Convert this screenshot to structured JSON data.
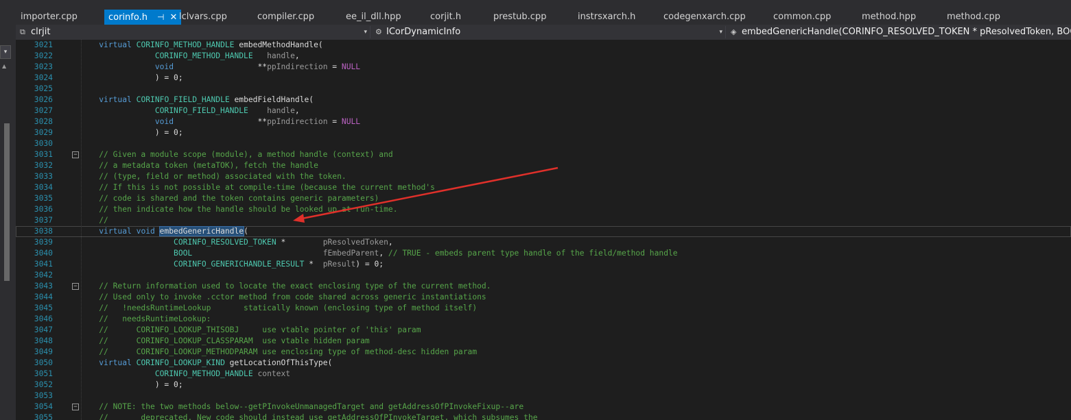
{
  "tabs": [
    {
      "label": "importer.cpp",
      "active": false
    },
    {
      "label": "corinfo.h",
      "active": true
    },
    {
      "label": "lclvars.cpp",
      "active": false
    },
    {
      "label": "compiler.cpp",
      "active": false
    },
    {
      "label": "ee_il_dll.hpp",
      "active": false
    },
    {
      "label": "corjit.h",
      "active": false
    },
    {
      "label": "prestub.cpp",
      "active": false
    },
    {
      "label": "instrsxarch.h",
      "active": false
    },
    {
      "label": "codegenxarch.cpp",
      "active": false
    },
    {
      "label": "common.cpp",
      "active": false
    },
    {
      "label": "method.hpp",
      "active": false
    },
    {
      "label": "method.cpp",
      "active": false
    }
  ],
  "tab_pin_glyph": "⊣",
  "tab_close_glyph": "✕",
  "left_close_glyph": "✕",
  "left_drop_glyph": "▾",
  "left_scroll_arrow_glyph": "▲",
  "navbar": {
    "project": "clrjit",
    "scope": "ICorDynamicInfo",
    "member": "embedGenericHandle(CORINFO_RESOLVED_TOKEN * pResolvedToken, BOOL fEm",
    "chevron_glyph": "▾"
  },
  "icons": {
    "project": "project-icon",
    "scope": "class-icon",
    "member": "method-icon"
  },
  "code_lines": [
    {
      "n": "3021",
      "fold": false,
      "tokens": [
        [
          "    ",
          ""
        ],
        [
          "virtual ",
          "kw"
        ],
        [
          "CORINFO_METHOD_HANDLE",
          "ty"
        ],
        [
          " embedMethodHandle(",
          ""
        ]
      ]
    },
    {
      "n": "3022",
      "fold": false,
      "tokens": [
        [
          "                ",
          ""
        ],
        [
          "CORINFO_METHOD_HANDLE",
          "ty"
        ],
        [
          "   ",
          ""
        ],
        [
          "handle",
          "pr"
        ],
        [
          ",",
          ""
        ]
      ]
    },
    {
      "n": "3023",
      "fold": false,
      "tokens": [
        [
          "                ",
          ""
        ],
        [
          "void",
          "kw"
        ],
        [
          "                  **",
          ""
        ],
        [
          "ppIndirection",
          "pr"
        ],
        [
          " = ",
          ""
        ],
        [
          "NULL",
          "mac"
        ]
      ]
    },
    {
      "n": "3024",
      "fold": false,
      "tokens": [
        [
          "                ) = 0;",
          ""
        ]
      ]
    },
    {
      "n": "3025",
      "fold": false,
      "tokens": []
    },
    {
      "n": "3026",
      "fold": false,
      "tokens": [
        [
          "    ",
          ""
        ],
        [
          "virtual ",
          "kw"
        ],
        [
          "CORINFO_FIELD_HANDLE",
          "ty"
        ],
        [
          " embedFieldHandle(",
          ""
        ]
      ]
    },
    {
      "n": "3027",
      "fold": false,
      "tokens": [
        [
          "                ",
          ""
        ],
        [
          "CORINFO_FIELD_HANDLE",
          "ty"
        ],
        [
          "    ",
          ""
        ],
        [
          "handle",
          "pr"
        ],
        [
          ",",
          ""
        ]
      ]
    },
    {
      "n": "3028",
      "fold": false,
      "tokens": [
        [
          "                ",
          ""
        ],
        [
          "void",
          "kw"
        ],
        [
          "                  **",
          ""
        ],
        [
          "ppIndirection",
          "pr"
        ],
        [
          " = ",
          ""
        ],
        [
          "NULL",
          "mac"
        ]
      ]
    },
    {
      "n": "3029",
      "fold": false,
      "tokens": [
        [
          "                ) = 0;",
          ""
        ]
      ]
    },
    {
      "n": "3030",
      "fold": false,
      "tokens": []
    },
    {
      "n": "3031",
      "fold": true,
      "tokens": [
        [
          "    ",
          ""
        ],
        [
          "// Given a module scope (module), a method handle (context) and",
          "cm"
        ]
      ]
    },
    {
      "n": "3032",
      "fold": false,
      "tokens": [
        [
          "    ",
          ""
        ],
        [
          "// a metadata token (metaTOK), fetch the handle",
          "cm"
        ]
      ]
    },
    {
      "n": "3033",
      "fold": false,
      "tokens": [
        [
          "    ",
          ""
        ],
        [
          "// (type, field or method) associated with the token.",
          "cm"
        ]
      ]
    },
    {
      "n": "3034",
      "fold": false,
      "tokens": [
        [
          "    ",
          ""
        ],
        [
          "// If this is not possible at compile-time (because the current method's",
          "cm"
        ]
      ]
    },
    {
      "n": "3035",
      "fold": false,
      "tokens": [
        [
          "    ",
          ""
        ],
        [
          "// code is shared and the token contains generic parameters)",
          "cm"
        ]
      ]
    },
    {
      "n": "3036",
      "fold": false,
      "tokens": [
        [
          "    ",
          ""
        ],
        [
          "// then indicate how the handle should be looked up at run-time.",
          "cm"
        ]
      ]
    },
    {
      "n": "3037",
      "fold": false,
      "tokens": [
        [
          "    ",
          ""
        ],
        [
          "//",
          "cm"
        ]
      ]
    },
    {
      "n": "3038",
      "fold": false,
      "current": true,
      "tokens": [
        [
          "    ",
          ""
        ],
        [
          "virtual ",
          "kw"
        ],
        [
          "void ",
          "kw"
        ],
        [
          "embedGenericHandle",
          "hl"
        ],
        [
          "(",
          ""
        ]
      ]
    },
    {
      "n": "3039",
      "fold": false,
      "tokens": [
        [
          "                    ",
          ""
        ],
        [
          "CORINFO_RESOLVED_TOKEN",
          "ty"
        ],
        [
          " *        ",
          ""
        ],
        [
          "pResolvedToken",
          "pr"
        ],
        [
          ",",
          ""
        ]
      ]
    },
    {
      "n": "3040",
      "fold": false,
      "tokens": [
        [
          "                    ",
          ""
        ],
        [
          "BOOL",
          "ty"
        ],
        [
          "                            ",
          ""
        ],
        [
          "fEmbedParent",
          "pr"
        ],
        [
          ", ",
          ""
        ],
        [
          "// TRUE - embeds parent type handle of the field/method handle",
          "cm"
        ]
      ]
    },
    {
      "n": "3041",
      "fold": false,
      "tokens": [
        [
          "                    ",
          ""
        ],
        [
          "CORINFO_GENERICHANDLE_RESULT",
          "ty"
        ],
        [
          " *  ",
          ""
        ],
        [
          "pResult",
          "pr"
        ],
        [
          ") = 0;",
          ""
        ]
      ]
    },
    {
      "n": "3042",
      "fold": false,
      "tokens": []
    },
    {
      "n": "3043",
      "fold": true,
      "tokens": [
        [
          "    ",
          ""
        ],
        [
          "// Return information used to locate the exact enclosing type of the current method.",
          "cm"
        ]
      ]
    },
    {
      "n": "3044",
      "fold": false,
      "tokens": [
        [
          "    ",
          ""
        ],
        [
          "// Used only to invoke .cctor method from code shared across generic instantiations",
          "cm"
        ]
      ]
    },
    {
      "n": "3045",
      "fold": false,
      "tokens": [
        [
          "    ",
          ""
        ],
        [
          "//   !needsRuntimeLookup       statically known (enclosing type of method itself)",
          "cm"
        ]
      ]
    },
    {
      "n": "3046",
      "fold": false,
      "tokens": [
        [
          "    ",
          ""
        ],
        [
          "//   needsRuntimeLookup:",
          "cm"
        ]
      ]
    },
    {
      "n": "3047",
      "fold": false,
      "tokens": [
        [
          "    ",
          ""
        ],
        [
          "//      CORINFO_LOOKUP_THISOBJ     use vtable pointer of 'this' param",
          "cm"
        ]
      ]
    },
    {
      "n": "3048",
      "fold": false,
      "tokens": [
        [
          "    ",
          ""
        ],
        [
          "//      CORINFO_LOOKUP_CLASSPARAM  use vtable hidden param",
          "cm"
        ]
      ]
    },
    {
      "n": "3049",
      "fold": false,
      "tokens": [
        [
          "    ",
          ""
        ],
        [
          "//      CORINFO_LOOKUP_METHODPARAM use enclosing type of method-desc hidden param",
          "cm"
        ]
      ]
    },
    {
      "n": "3050",
      "fold": false,
      "tokens": [
        [
          "    ",
          ""
        ],
        [
          "virtual ",
          "kw"
        ],
        [
          "CORINFO_LOOKUP_KIND",
          "ty"
        ],
        [
          " getLocationOfThisType(",
          ""
        ]
      ]
    },
    {
      "n": "3051",
      "fold": false,
      "tokens": [
        [
          "                ",
          ""
        ],
        [
          "CORINFO_METHOD_HANDLE",
          "ty"
        ],
        [
          " ",
          ""
        ],
        [
          "context",
          "pr"
        ]
      ]
    },
    {
      "n": "3052",
      "fold": false,
      "tokens": [
        [
          "                ) = 0;",
          ""
        ]
      ]
    },
    {
      "n": "3053",
      "fold": false,
      "tokens": []
    },
    {
      "n": "3054",
      "fold": true,
      "tokens": [
        [
          "    ",
          ""
        ],
        [
          "// NOTE: the two methods below--getPInvokeUnmanagedTarget and getAddressOfPInvokeFixup--are",
          "cm"
        ]
      ]
    },
    {
      "n": "3055",
      "fold": false,
      "tokens": [
        [
          "    ",
          ""
        ],
        [
          "//       deprecated. New code should instead use getAddressOfPInvokeTarget, which subsumes the",
          "cm"
        ]
      ]
    }
  ],
  "annotation_arrow_color": "#e0302a"
}
